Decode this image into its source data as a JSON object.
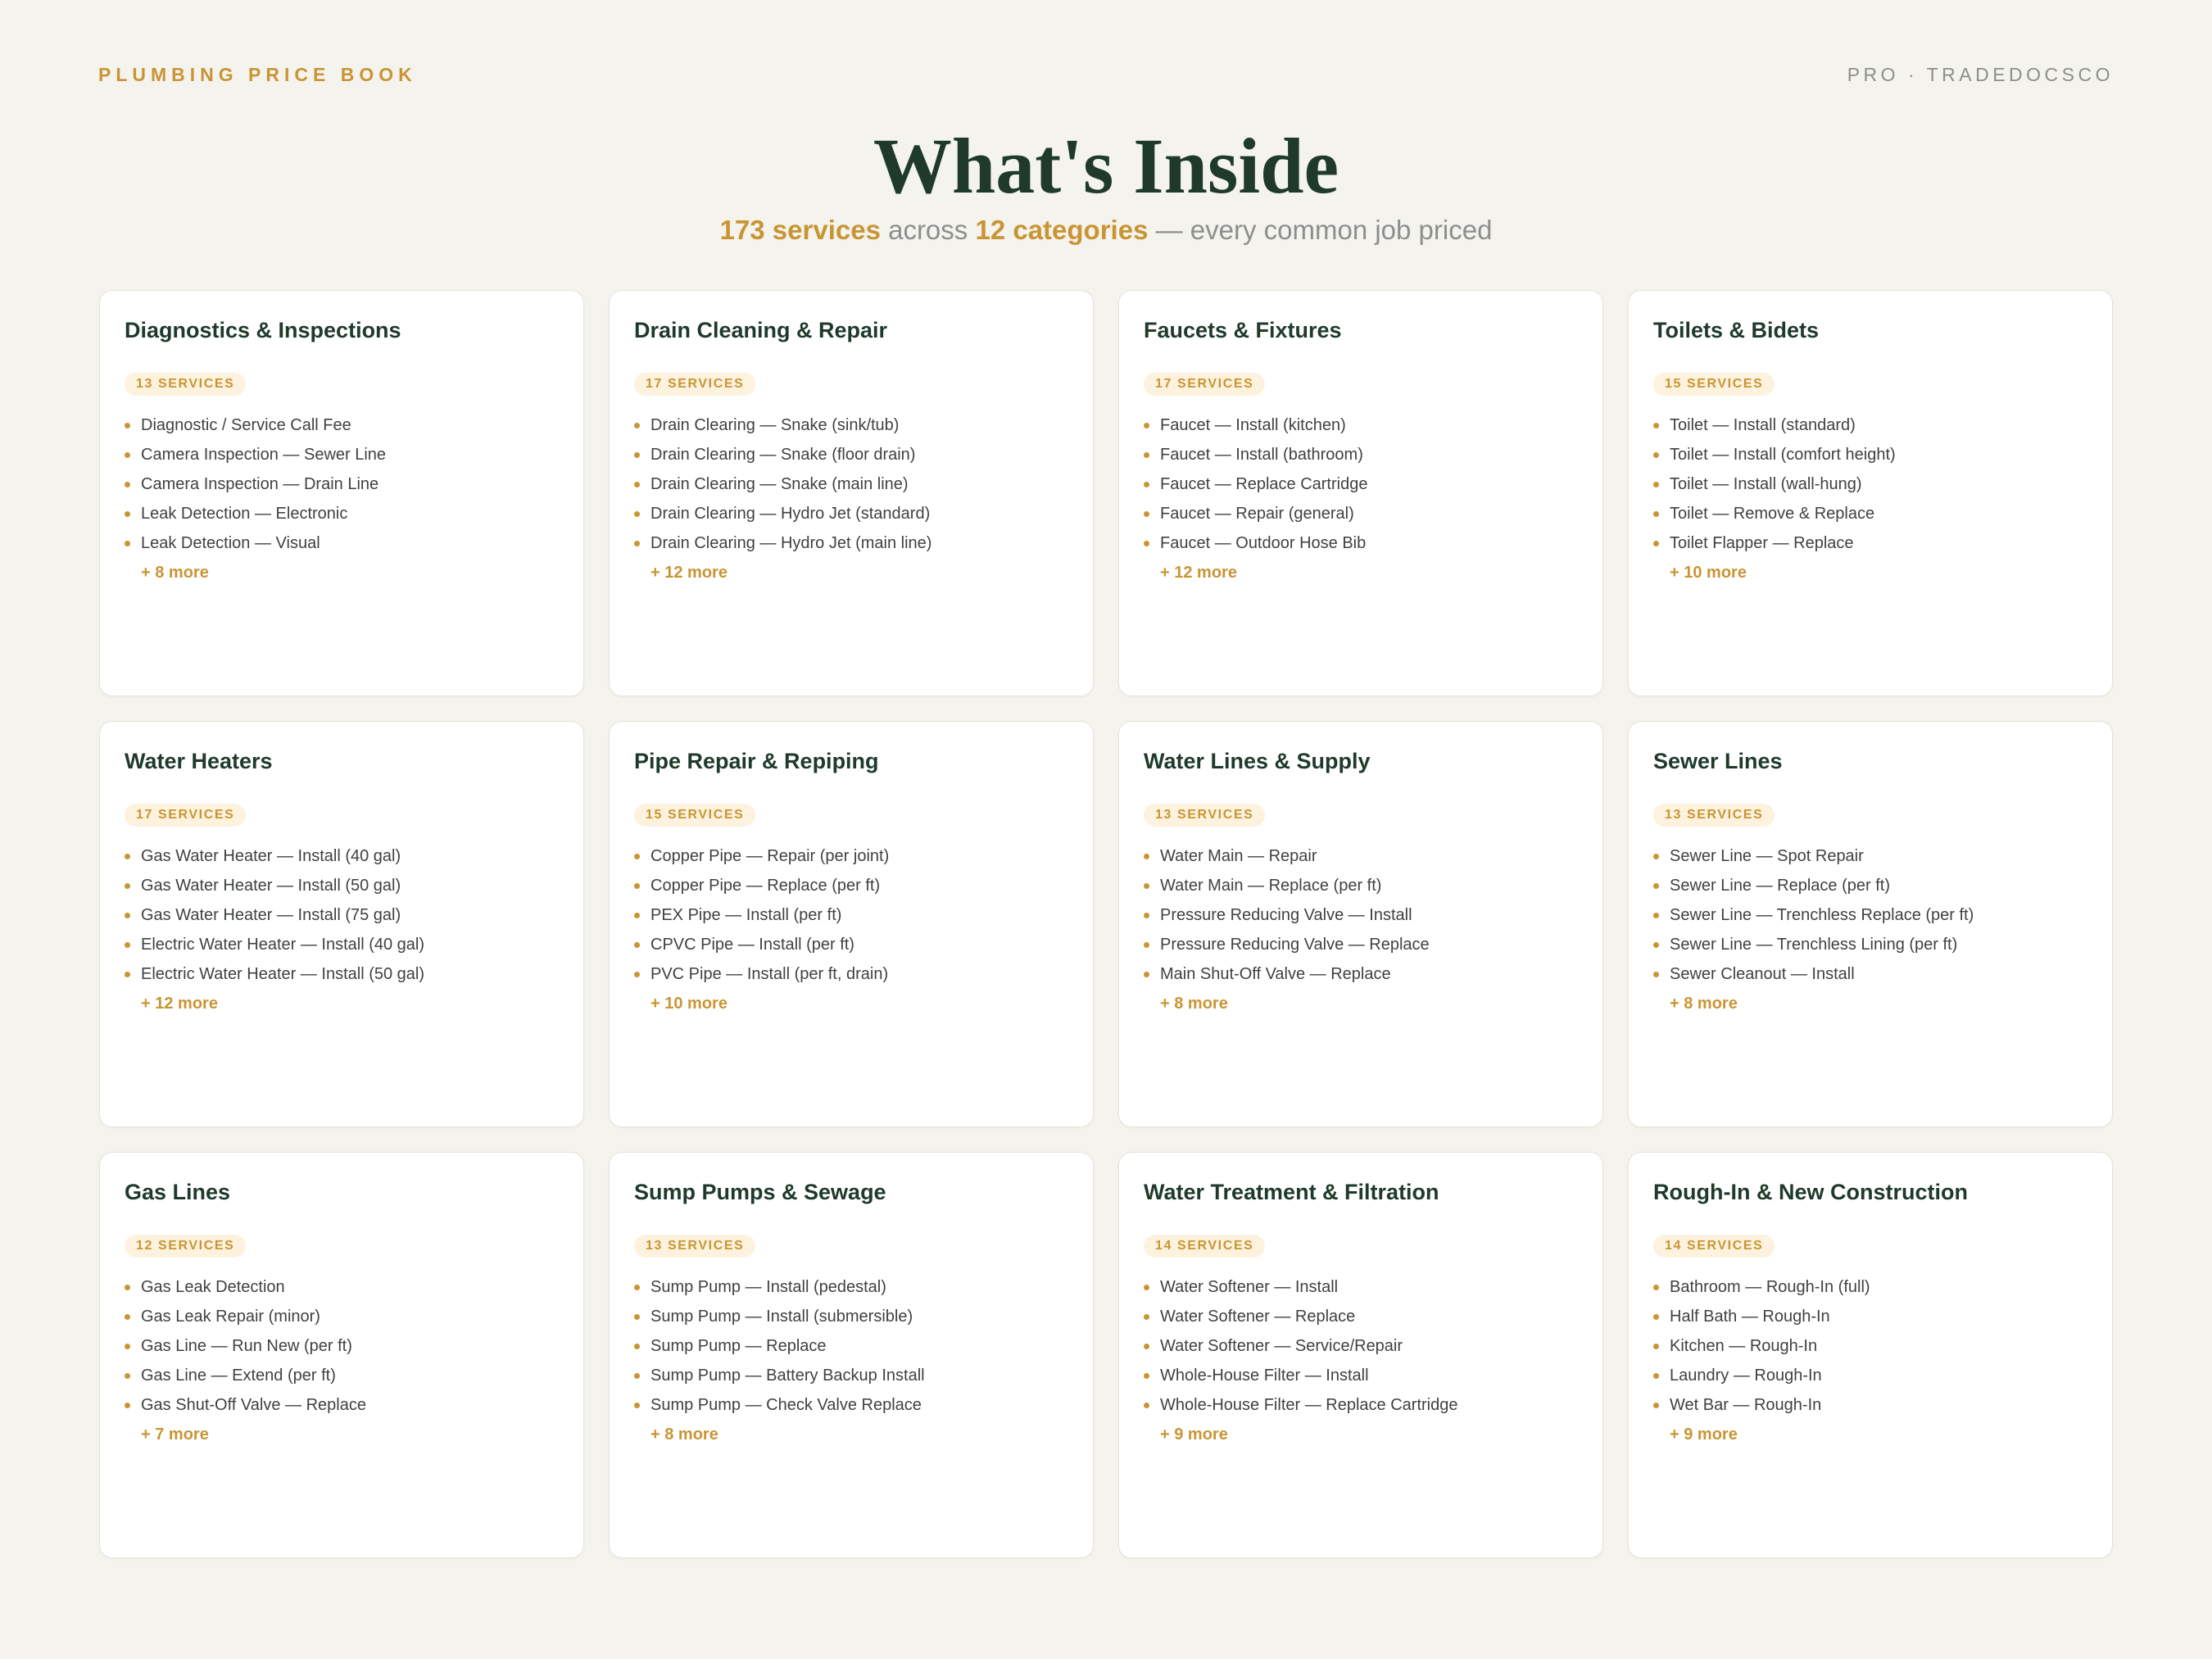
{
  "header": {
    "brand": "PLUMBING PRICE BOOK",
    "tag": "PRO · TRADEDOCSCO"
  },
  "hero": {
    "title": "What's Inside",
    "services_count": "173 services",
    "across": "across",
    "categories_count": "12 categories",
    "tail": "— every common job priced"
  },
  "badge_suffix": "SERVICES",
  "categories": [
    {
      "title": "Diagnostics & Inspections",
      "count": "13",
      "items": [
        "Diagnostic / Service Call Fee",
        "Camera Inspection — Sewer Line",
        "Camera Inspection — Drain Line",
        "Leak Detection — Electronic",
        "Leak Detection — Visual"
      ],
      "more": "+ 8 more"
    },
    {
      "title": "Drain Cleaning & Repair",
      "count": "17",
      "items": [
        "Drain Clearing — Snake (sink/tub)",
        "Drain Clearing — Snake (floor drain)",
        "Drain Clearing — Snake (main line)",
        "Drain Clearing — Hydro Jet (standard)",
        "Drain Clearing — Hydro Jet (main line)"
      ],
      "more": "+ 12 more"
    },
    {
      "title": "Faucets & Fixtures",
      "count": "17",
      "items": [
        "Faucet — Install (kitchen)",
        "Faucet — Install (bathroom)",
        "Faucet — Replace Cartridge",
        "Faucet — Repair (general)",
        "Faucet — Outdoor Hose Bib"
      ],
      "more": "+ 12 more"
    },
    {
      "title": "Toilets & Bidets",
      "count": "15",
      "items": [
        "Toilet — Install (standard)",
        "Toilet — Install (comfort height)",
        "Toilet — Install (wall-hung)",
        "Toilet — Remove & Replace",
        "Toilet Flapper — Replace"
      ],
      "more": "+ 10 more"
    },
    {
      "title": "Water Heaters",
      "count": "17",
      "items": [
        "Gas Water Heater — Install (40 gal)",
        "Gas Water Heater — Install (50 gal)",
        "Gas Water Heater — Install (75 gal)",
        "Electric Water Heater — Install (40 gal)",
        "Electric Water Heater — Install (50 gal)"
      ],
      "more": "+ 12 more"
    },
    {
      "title": "Pipe Repair & Repiping",
      "count": "15",
      "items": [
        "Copper Pipe — Repair (per joint)",
        "Copper Pipe — Replace (per ft)",
        "PEX Pipe — Install (per ft)",
        "CPVC Pipe — Install (per ft)",
        "PVC Pipe — Install (per ft, drain)"
      ],
      "more": "+ 10 more"
    },
    {
      "title": "Water Lines & Supply",
      "count": "13",
      "items": [
        "Water Main — Repair",
        "Water Main — Replace (per ft)",
        "Pressure Reducing Valve — Install",
        "Pressure Reducing Valve — Replace",
        "Main Shut-Off Valve — Replace"
      ],
      "more": "+ 8 more"
    },
    {
      "title": "Sewer Lines",
      "count": "13",
      "items": [
        "Sewer Line — Spot Repair",
        "Sewer Line — Replace (per ft)",
        "Sewer Line — Trenchless Replace (per ft)",
        "Sewer Line — Trenchless Lining (per ft)",
        "Sewer Cleanout — Install"
      ],
      "more": "+ 8 more"
    },
    {
      "title": "Gas Lines",
      "count": "12",
      "items": [
        "Gas Leak Detection",
        "Gas Leak Repair (minor)",
        "Gas Line — Run New (per ft)",
        "Gas Line — Extend (per ft)",
        "Gas Shut-Off Valve — Replace"
      ],
      "more": "+ 7 more"
    },
    {
      "title": "Sump Pumps & Sewage",
      "count": "13",
      "items": [
        "Sump Pump — Install (pedestal)",
        "Sump Pump — Install (submersible)",
        "Sump Pump — Replace",
        "Sump Pump — Battery Backup Install",
        "Sump Pump — Check Valve Replace"
      ],
      "more": "+ 8 more"
    },
    {
      "title": "Water Treatment & Filtration",
      "count": "14",
      "items": [
        "Water Softener — Install",
        "Water Softener — Replace",
        "Water Softener — Service/Repair",
        "Whole-House Filter — Install",
        "Whole-House Filter — Replace Cartridge"
      ],
      "more": "+ 9 more"
    },
    {
      "title": "Rough-In & New Construction",
      "count": "14",
      "items": [
        "Bathroom — Rough-In (full)",
        "Half Bath — Rough-In",
        "Kitchen — Rough-In",
        "Laundry — Rough-In",
        "Wet Bar — Rough-In"
      ],
      "more": "+ 9 more"
    }
  ]
}
